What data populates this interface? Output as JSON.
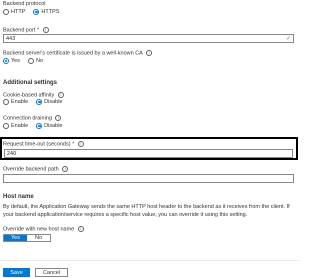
{
  "backend_protocol": {
    "label": "Backend protocol",
    "options": [
      "HTTP",
      "HTTPS"
    ],
    "selected": "HTTPS"
  },
  "backend_port": {
    "label": "Backend port",
    "required_mark": "*",
    "value": "443"
  },
  "certificate_ca": {
    "label": "Backend server's certificate is issued by a well-known CA",
    "options": [
      "Yes",
      "No"
    ],
    "selected": "Yes"
  },
  "additional_settings": {
    "heading": "Additional settings"
  },
  "cookie_affinity": {
    "label": "Cookie-based affinity",
    "options": [
      "Enable",
      "Disable"
    ],
    "selected": "Disable"
  },
  "connection_draining": {
    "label": "Connection draining",
    "options": [
      "Enable",
      "Disable"
    ],
    "selected": "Disable"
  },
  "request_timeout": {
    "label": "Request time-out (seconds)",
    "required_mark": "*",
    "value": "240"
  },
  "override_path": {
    "label": "Override backend path",
    "value": ""
  },
  "host_name": {
    "heading": "Host name",
    "description": "By default, the Application Gateway sends the same HTTP host header to the backend as it receives from the client. If your backend application/service requires a specific host value, you can override it using this setting.",
    "override_label": "Override with new host name",
    "toggle_options": [
      "Yes",
      "No"
    ],
    "selected": "Yes"
  },
  "footer": {
    "save_label": "Save",
    "cancel_label": "Cancel"
  },
  "info_glyph": "i"
}
